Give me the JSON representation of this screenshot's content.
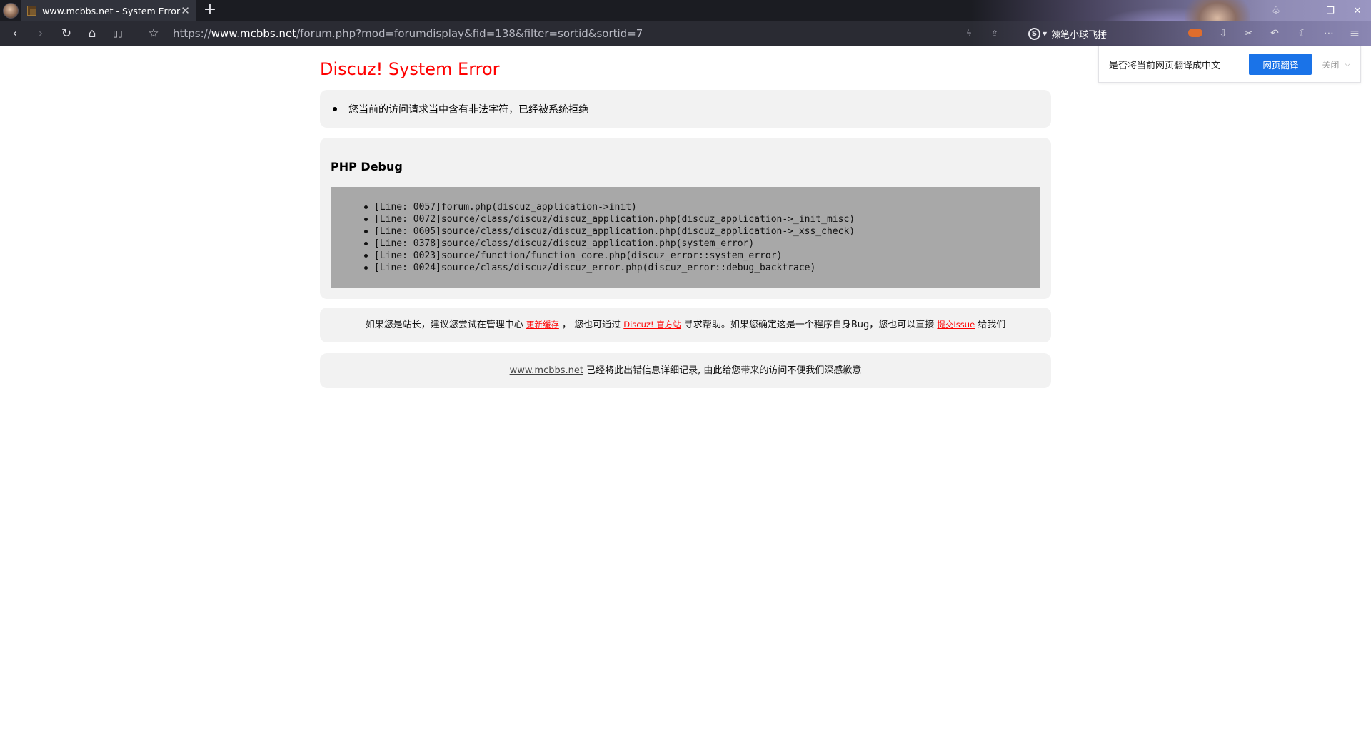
{
  "browser": {
    "tab_title": "www.mcbbs.net - System Error",
    "tab_close": "✕",
    "new_tab": "+",
    "url_scheme": "https://",
    "url_host": "www.mcbbs.net",
    "url_path": "/forum.php?mod=forumdisplay&fid=138&filter=sortid&sortid=7",
    "search_engine_label": "S",
    "search_hint": "辣笔小球飞捶",
    "window_controls": {
      "minimize": "–",
      "restore": "❐",
      "close": "✕"
    },
    "icons": {
      "back": "‹",
      "forward": "›",
      "reload": "↻",
      "home": "⌂",
      "reader": "▯▯",
      "bookmark": "☆",
      "lightning": "ϟ",
      "share": "⇪",
      "download": "⇩",
      "scissors": "✂",
      "undo": "↶",
      "night": "☾",
      "more": "⋯",
      "menu": "≡",
      "skin": "♧"
    }
  },
  "translate_bar": {
    "question": "是否将当前网页翻译成中文",
    "translate_button": "网页翻译",
    "close_button": "关闭",
    "chevron": "⌵"
  },
  "error_page": {
    "title": "Discuz! System Error",
    "message": "您当前的访问请求当中含有非法字符，已经被系统拒绝",
    "debug_title": "PHP Debug",
    "trace": [
      "[Line: 0057]forum.php(discuz_application->init)",
      "[Line: 0072]source/class/discuz/discuz_application.php(discuz_application->_init_misc)",
      "[Line: 0605]source/class/discuz/discuz_application.php(discuz_application->_xss_check)",
      "[Line: 0378]source/class/discuz/discuz_application.php(system_error)",
      "[Line: 0023]source/function/function_core.php(discuz_error::system_error)",
      "[Line: 0024]source/class/discuz/discuz_error.php(discuz_error::debug_backtrace)"
    ],
    "help": {
      "part1": "如果您是站长，建议您尝试在管理中心 ",
      "link1": "更新缓存",
      "part2": " ， 您也可通过 ",
      "link2": "Discuz! 官方站",
      "part3": " 寻求帮助。如果您确定这是一个程序自身Bug，您也可以直接 ",
      "link3": "提交Issue",
      "part4": " 给我们"
    },
    "note": {
      "site_link": "www.mcbbs.net",
      "text": " 已经将此出错信息详细记录, 由此给您带来的访问不便我们深感歉意"
    }
  }
}
